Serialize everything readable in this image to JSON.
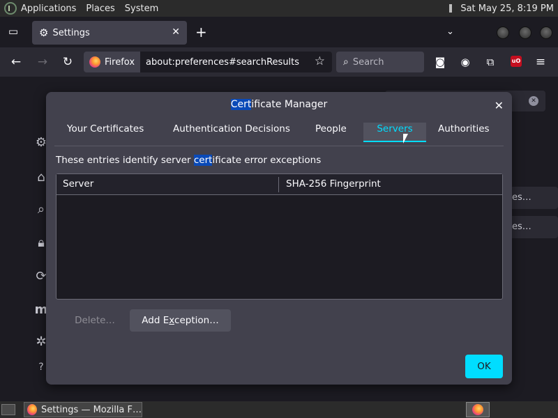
{
  "system_panel": {
    "menus": [
      "Applications",
      "Places",
      "System"
    ],
    "clock": "Sat May 25,  8:19 PM"
  },
  "browser": {
    "tab_title": "Settings",
    "identity_label": "Firefox",
    "url": "about:preferences#searchResults",
    "search_placeholder": "Search"
  },
  "dialog": {
    "title_highlight": "Cert",
    "title_rest": "ificate Manager",
    "tabs": [
      "Your Certificates",
      "Authentication Decisions",
      "People",
      "Servers",
      "Authorities"
    ],
    "active_tab": "Servers",
    "description_pre": "These entries identify server ",
    "description_highlight": "cert",
    "description_post": "ificate error exceptions",
    "columns": [
      "Server",
      "SHA-256 Fingerprint"
    ],
    "delete_label": "Delete…",
    "add_exception_label_pre": "Add E",
    "add_exception_label_key": "x",
    "add_exception_label_post": "ception…",
    "ok_label": "OK"
  },
  "background": {
    "button_fragments": [
      "es…",
      "es…"
    ]
  },
  "taskbar": {
    "task_label": "Settings — Mozilla F…"
  },
  "colors": {
    "accent": "#00ddff",
    "highlight": "#0a4ab8",
    "dialog_bg": "#42414d",
    "page_bg": "#1c1b22"
  }
}
